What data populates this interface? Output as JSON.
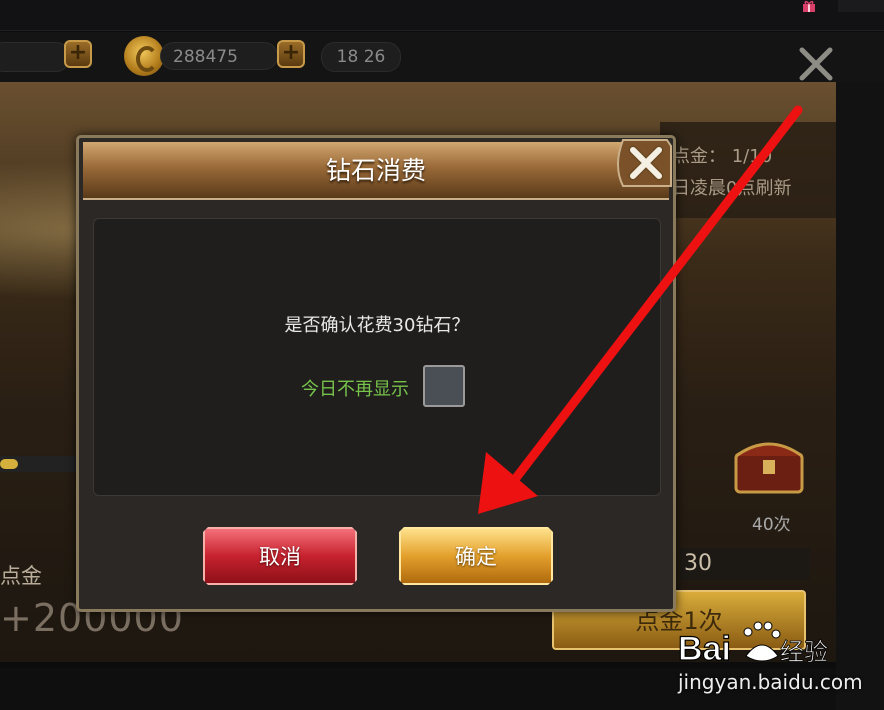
{
  "hud": {
    "coins": "288475",
    "time": "18  26",
    "plus_symbol": "+"
  },
  "background": {
    "info_line1": "点金：  1/10",
    "info_line2": "日凌晨0点刷新",
    "chest_count": "40次",
    "cost_value": "30",
    "left_label": "点金",
    "left_amount": "+200000",
    "draw_button": "点金1次"
  },
  "dialog": {
    "title": "钻石消费",
    "message": "是否确认花费30钻石？",
    "dont_show_label": "今日不再显示",
    "dont_show_checked": false,
    "cancel_label": "取消",
    "ok_label": "确定"
  },
  "watermark": {
    "logo_text": "Bai du 经验",
    "url": "jingyan.baidu.com"
  },
  "colors": {
    "arrow": "#ee1111",
    "dont_show_label": "#77c24a",
    "cancel": "#c6222e",
    "ok": "#e3a02c"
  }
}
